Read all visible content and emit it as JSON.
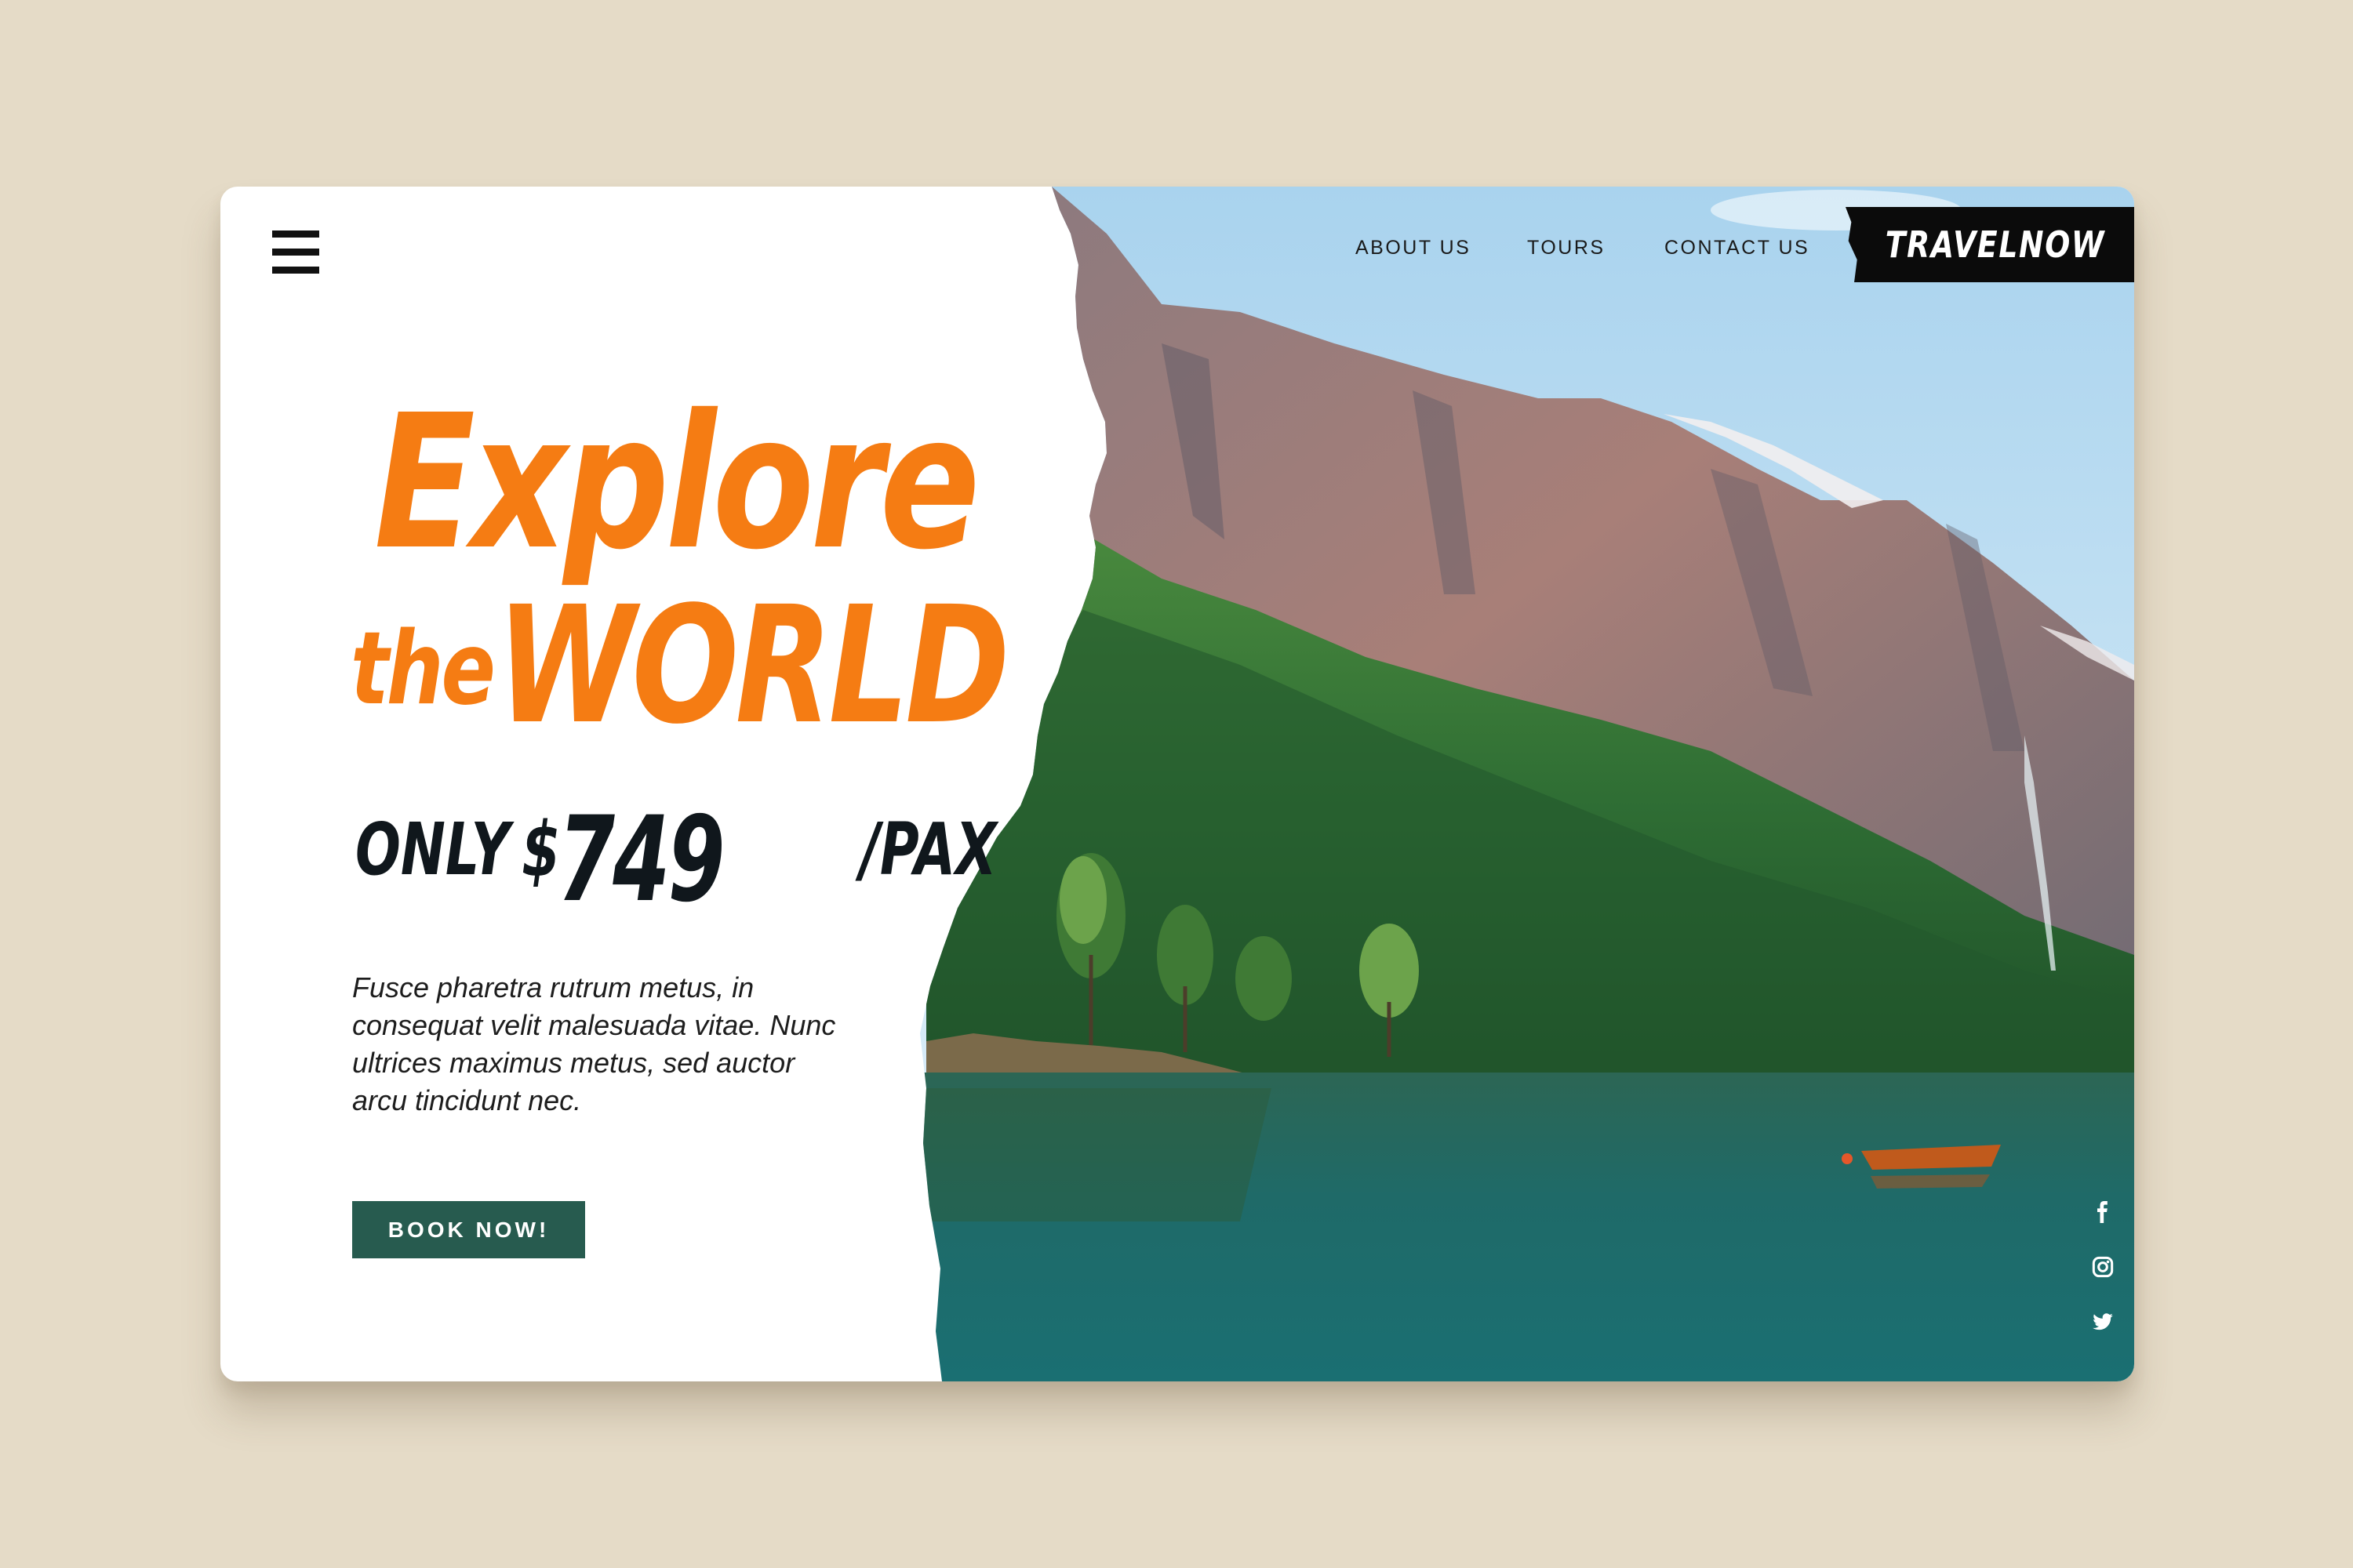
{
  "nav": {
    "menu_icon": "hamburger-menu-icon",
    "links": [
      "ABOUT US",
      "TOURS",
      "CONTACT US"
    ],
    "brand": "TRAVELNOW"
  },
  "hero": {
    "headline_line1": "Explore",
    "headline_the": "the",
    "headline_world": "WORLD",
    "price_only": "ONLY",
    "price_currency": "$",
    "price_amount": "749",
    "price_unit": "/PAX",
    "description": "Fusce pharetra rutrum metus, in consequat velit malesuada vitae. Nunc ultrices maximus metus, sed auctor arcu tincidunt nec.",
    "cta_label": "BOOK NOW!"
  },
  "social": {
    "icons": [
      "facebook-icon",
      "instagram-icon",
      "twitter-icon"
    ]
  },
  "colors": {
    "background": "#e5dbc7",
    "accent_orange": "#f57c13",
    "button_green": "#275b4f",
    "brand_black": "#0b0b0b",
    "text_dark": "#10171c"
  }
}
